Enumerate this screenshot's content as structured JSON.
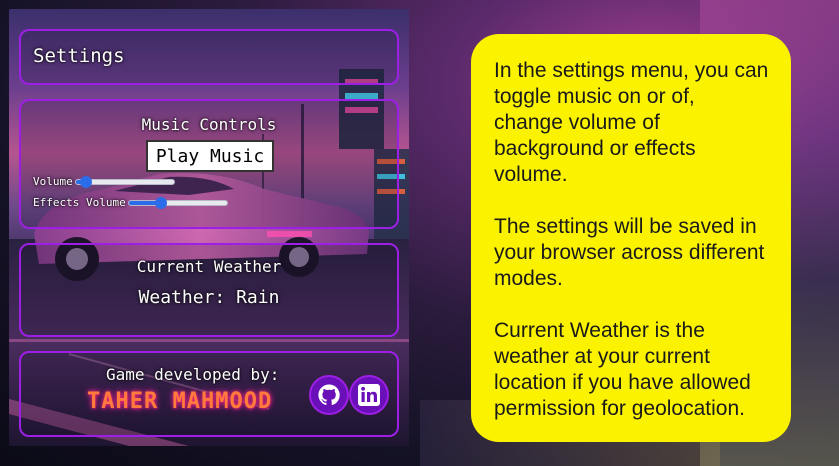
{
  "settings": {
    "title": "Settings"
  },
  "music": {
    "title": "Music Controls",
    "play_label": "Play Music",
    "volume_label": "Volume",
    "volume_value": 0.1,
    "effects_label": "Effects Volume",
    "effects_value": 0.33
  },
  "weather": {
    "title": "Current Weather",
    "value": "Weather: Rain"
  },
  "credits": {
    "label": "Game developed by:",
    "author": "TAHER MAHMOOD"
  },
  "icons": {
    "github": "github-icon",
    "linkedin": "linkedin-icon"
  },
  "info": {
    "paragraphs": [
      "In the settings menu, you can toggle music on or of, change volume of background or effects volume.",
      "The settings will be saved in your browser across different modes.",
      "Current Weather is the weather at your current location if you have allowed permission for geolocation."
    ]
  },
  "colors": {
    "accent_border": "#9d1fe6",
    "info_background": "#fbf200",
    "slider_blue": "#2b6de8"
  }
}
